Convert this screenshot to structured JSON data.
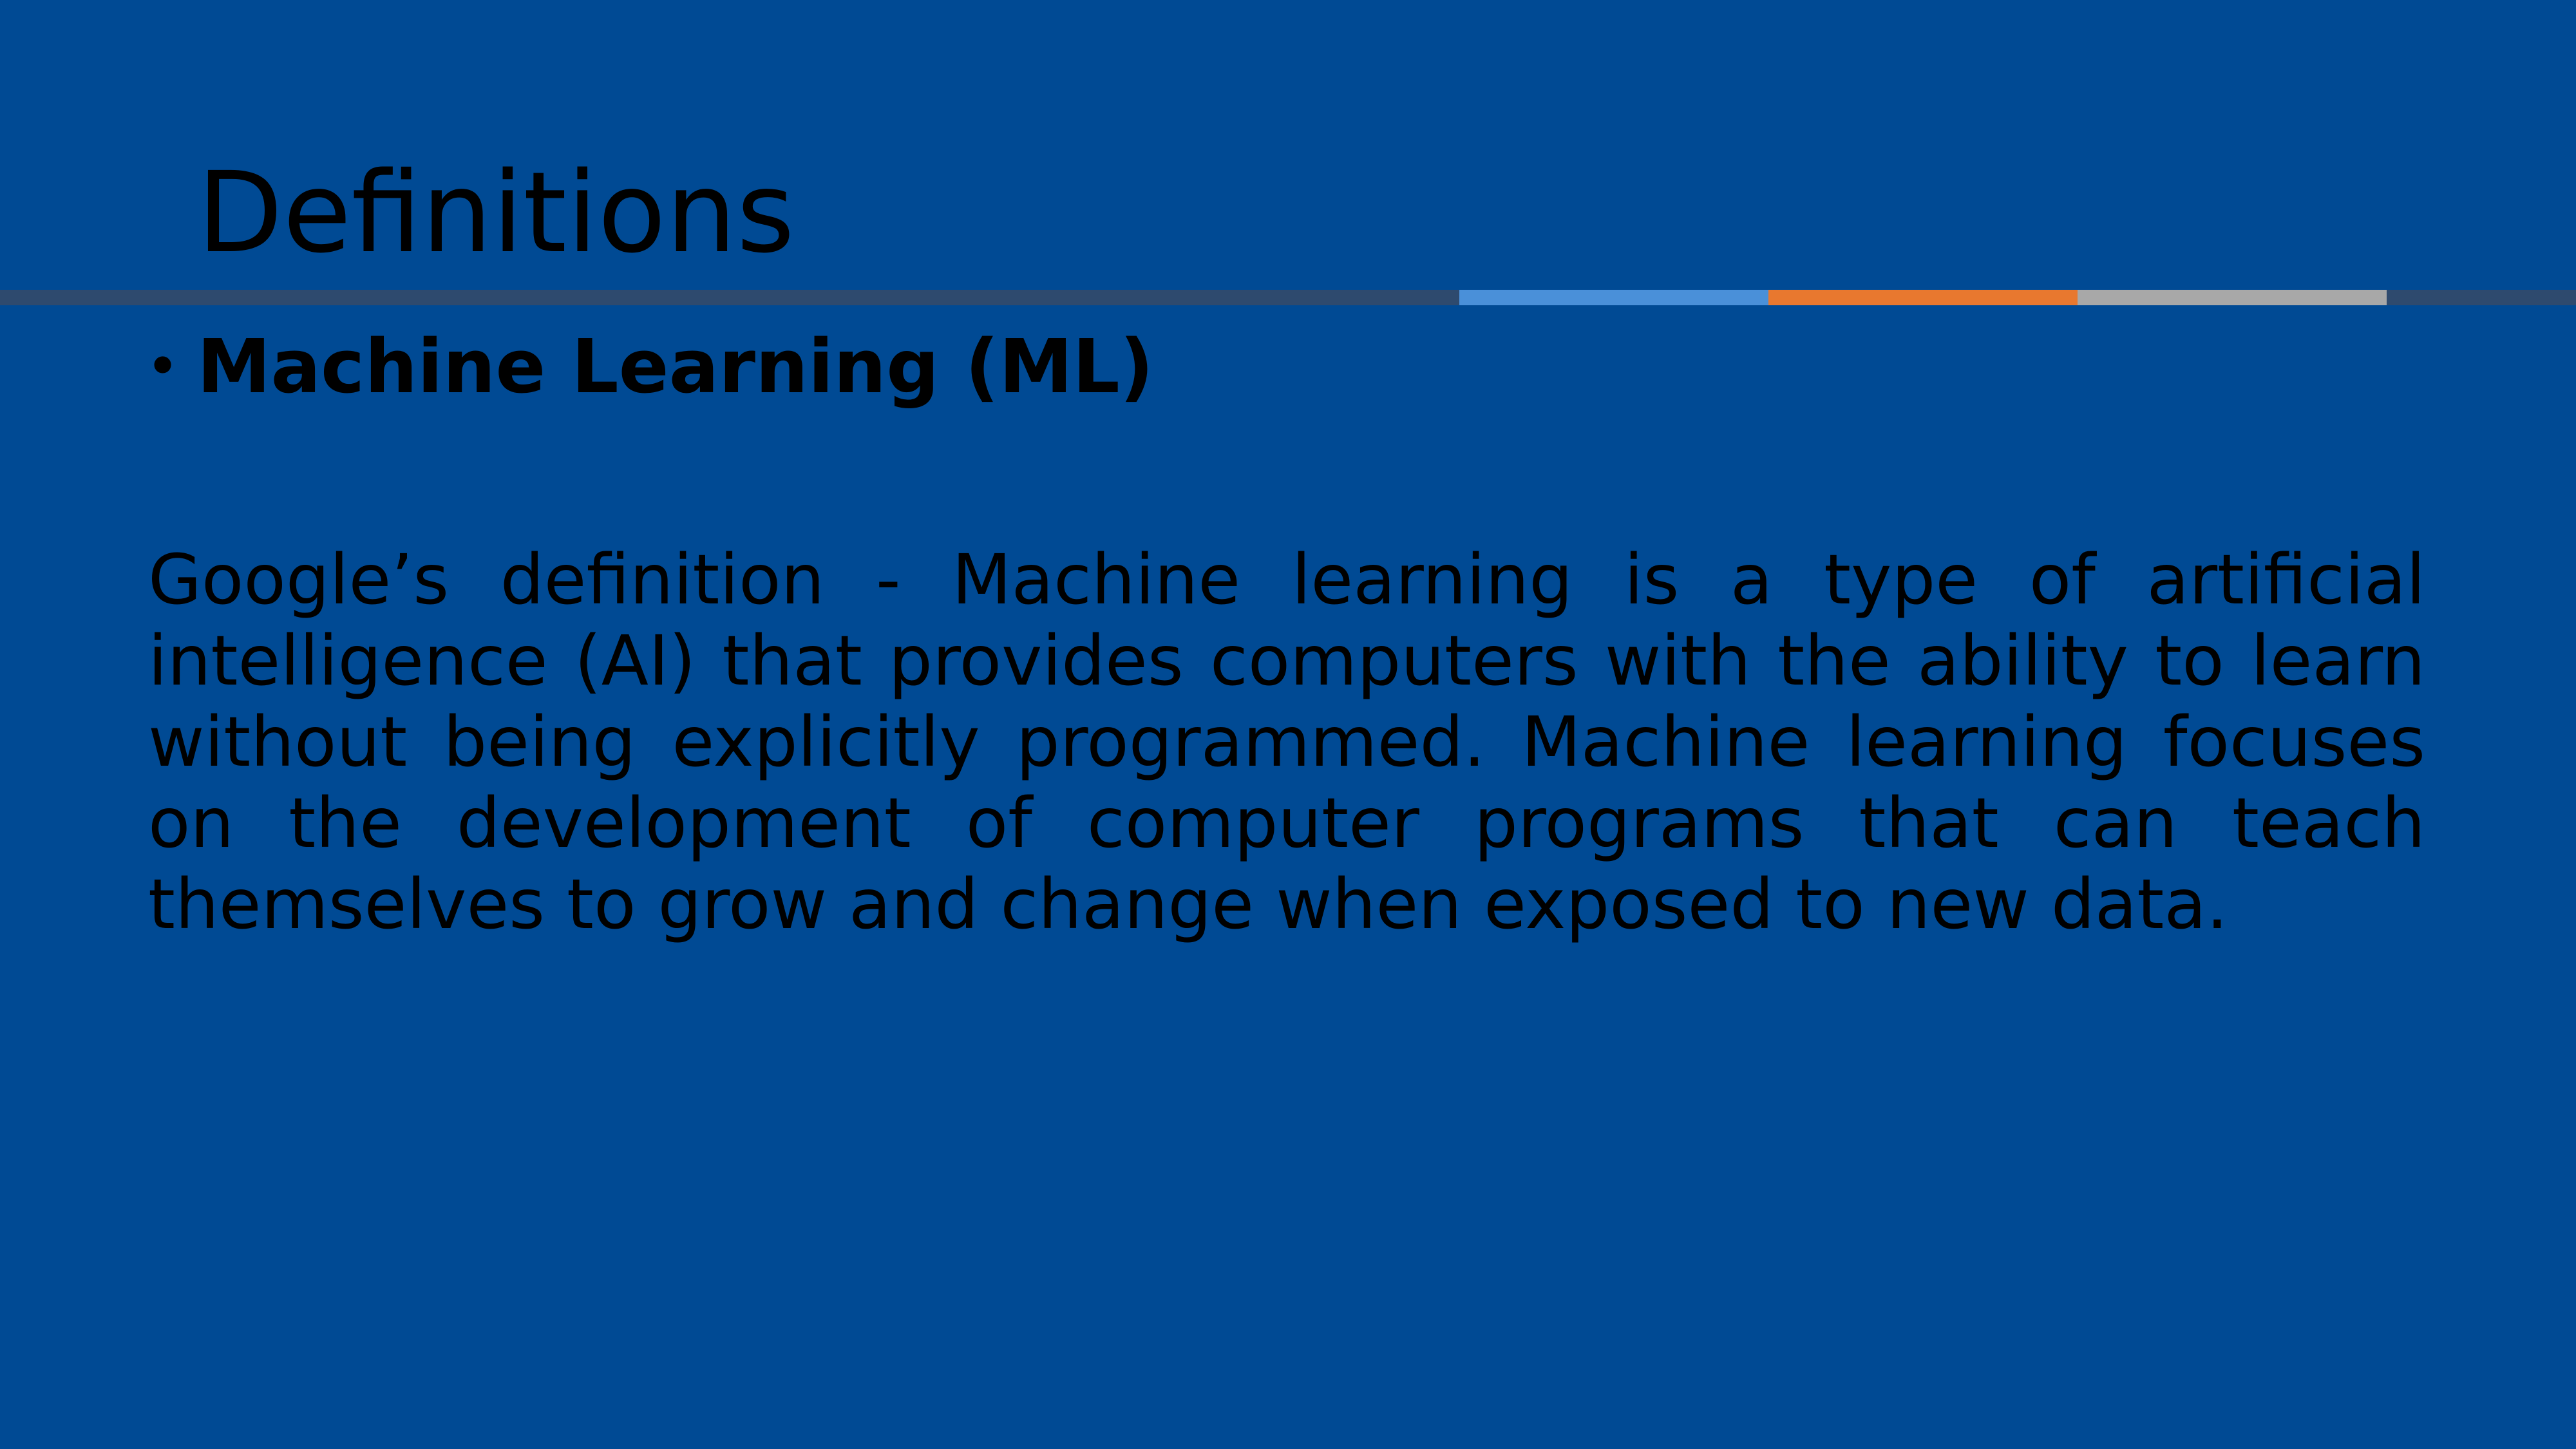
{
  "slide": {
    "title": "Definitions",
    "bullet_symbol": "•",
    "bullet_heading": "Machine Learning (ML)",
    "paragraph": "Google’s definition - Machine learning is a type of artificial intelligence (AI) that provides computers with the ability to learn without being explicitly programmed. Machine learning focuses on the development of computer programs that can teach themselves to grow and change when exposed to new data."
  },
  "colors": {
    "background": "#004a94",
    "text": "#000000",
    "rule_dark": "#2e4a6e",
    "rule_blue": "#4a90d9",
    "rule_orange": "#e8782f",
    "rule_gray": "#a8a8a8"
  }
}
